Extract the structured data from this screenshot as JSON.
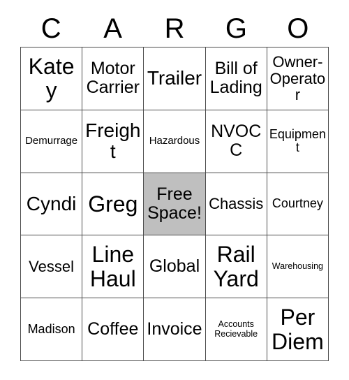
{
  "card": {
    "title_letters": [
      "C",
      "A",
      "R",
      "G",
      "O"
    ],
    "free_space_color": "#bfbfbf",
    "border_color": "#4d4d4d",
    "background_color": "#ffffff",
    "text_color": "#000000",
    "rows": [
      [
        {
          "label": "Katey",
          "size": "xxl",
          "free": false
        },
        {
          "label": "Motor Carrier",
          "size": "lg",
          "free": false
        },
        {
          "label": "Trailer",
          "size": "xl",
          "free": false
        },
        {
          "label": "Bill of Lading",
          "size": "lg",
          "free": false
        },
        {
          "label": "Owner-Operator",
          "size": "md",
          "free": false
        }
      ],
      [
        {
          "label": "Demurrage",
          "size": "xs",
          "free": false
        },
        {
          "label": "Freight",
          "size": "xl",
          "free": false
        },
        {
          "label": "Hazardous",
          "size": "xs",
          "free": false
        },
        {
          "label": "NVOCC",
          "size": "lg",
          "free": false
        },
        {
          "label": "Equipment",
          "size": "sm",
          "free": false
        }
      ],
      [
        {
          "label": "Cyndi",
          "size": "xl",
          "free": false
        },
        {
          "label": "Greg",
          "size": "xxl",
          "free": false
        },
        {
          "label": "Free Space!",
          "size": "lg",
          "free": true
        },
        {
          "label": "Chassis",
          "size": "md",
          "free": false
        },
        {
          "label": "Courtney",
          "size": "sm",
          "free": false
        }
      ],
      [
        {
          "label": "Vessel",
          "size": "md",
          "free": false
        },
        {
          "label": "Line Haul",
          "size": "xxl",
          "free": false
        },
        {
          "label": "Global",
          "size": "lg",
          "free": false
        },
        {
          "label": "Rail Yard",
          "size": "xxl",
          "free": false
        },
        {
          "label": "Warehousing",
          "size": "xxs",
          "free": false
        }
      ],
      [
        {
          "label": "Madison",
          "size": "sm",
          "free": false
        },
        {
          "label": "Coffee",
          "size": "lg",
          "free": false
        },
        {
          "label": "Invoice",
          "size": "lg",
          "free": false
        },
        {
          "label": "Accounts Recievable",
          "size": "xxs",
          "free": false
        },
        {
          "label": "Per Diem",
          "size": "xxl",
          "free": false
        }
      ]
    ]
  }
}
